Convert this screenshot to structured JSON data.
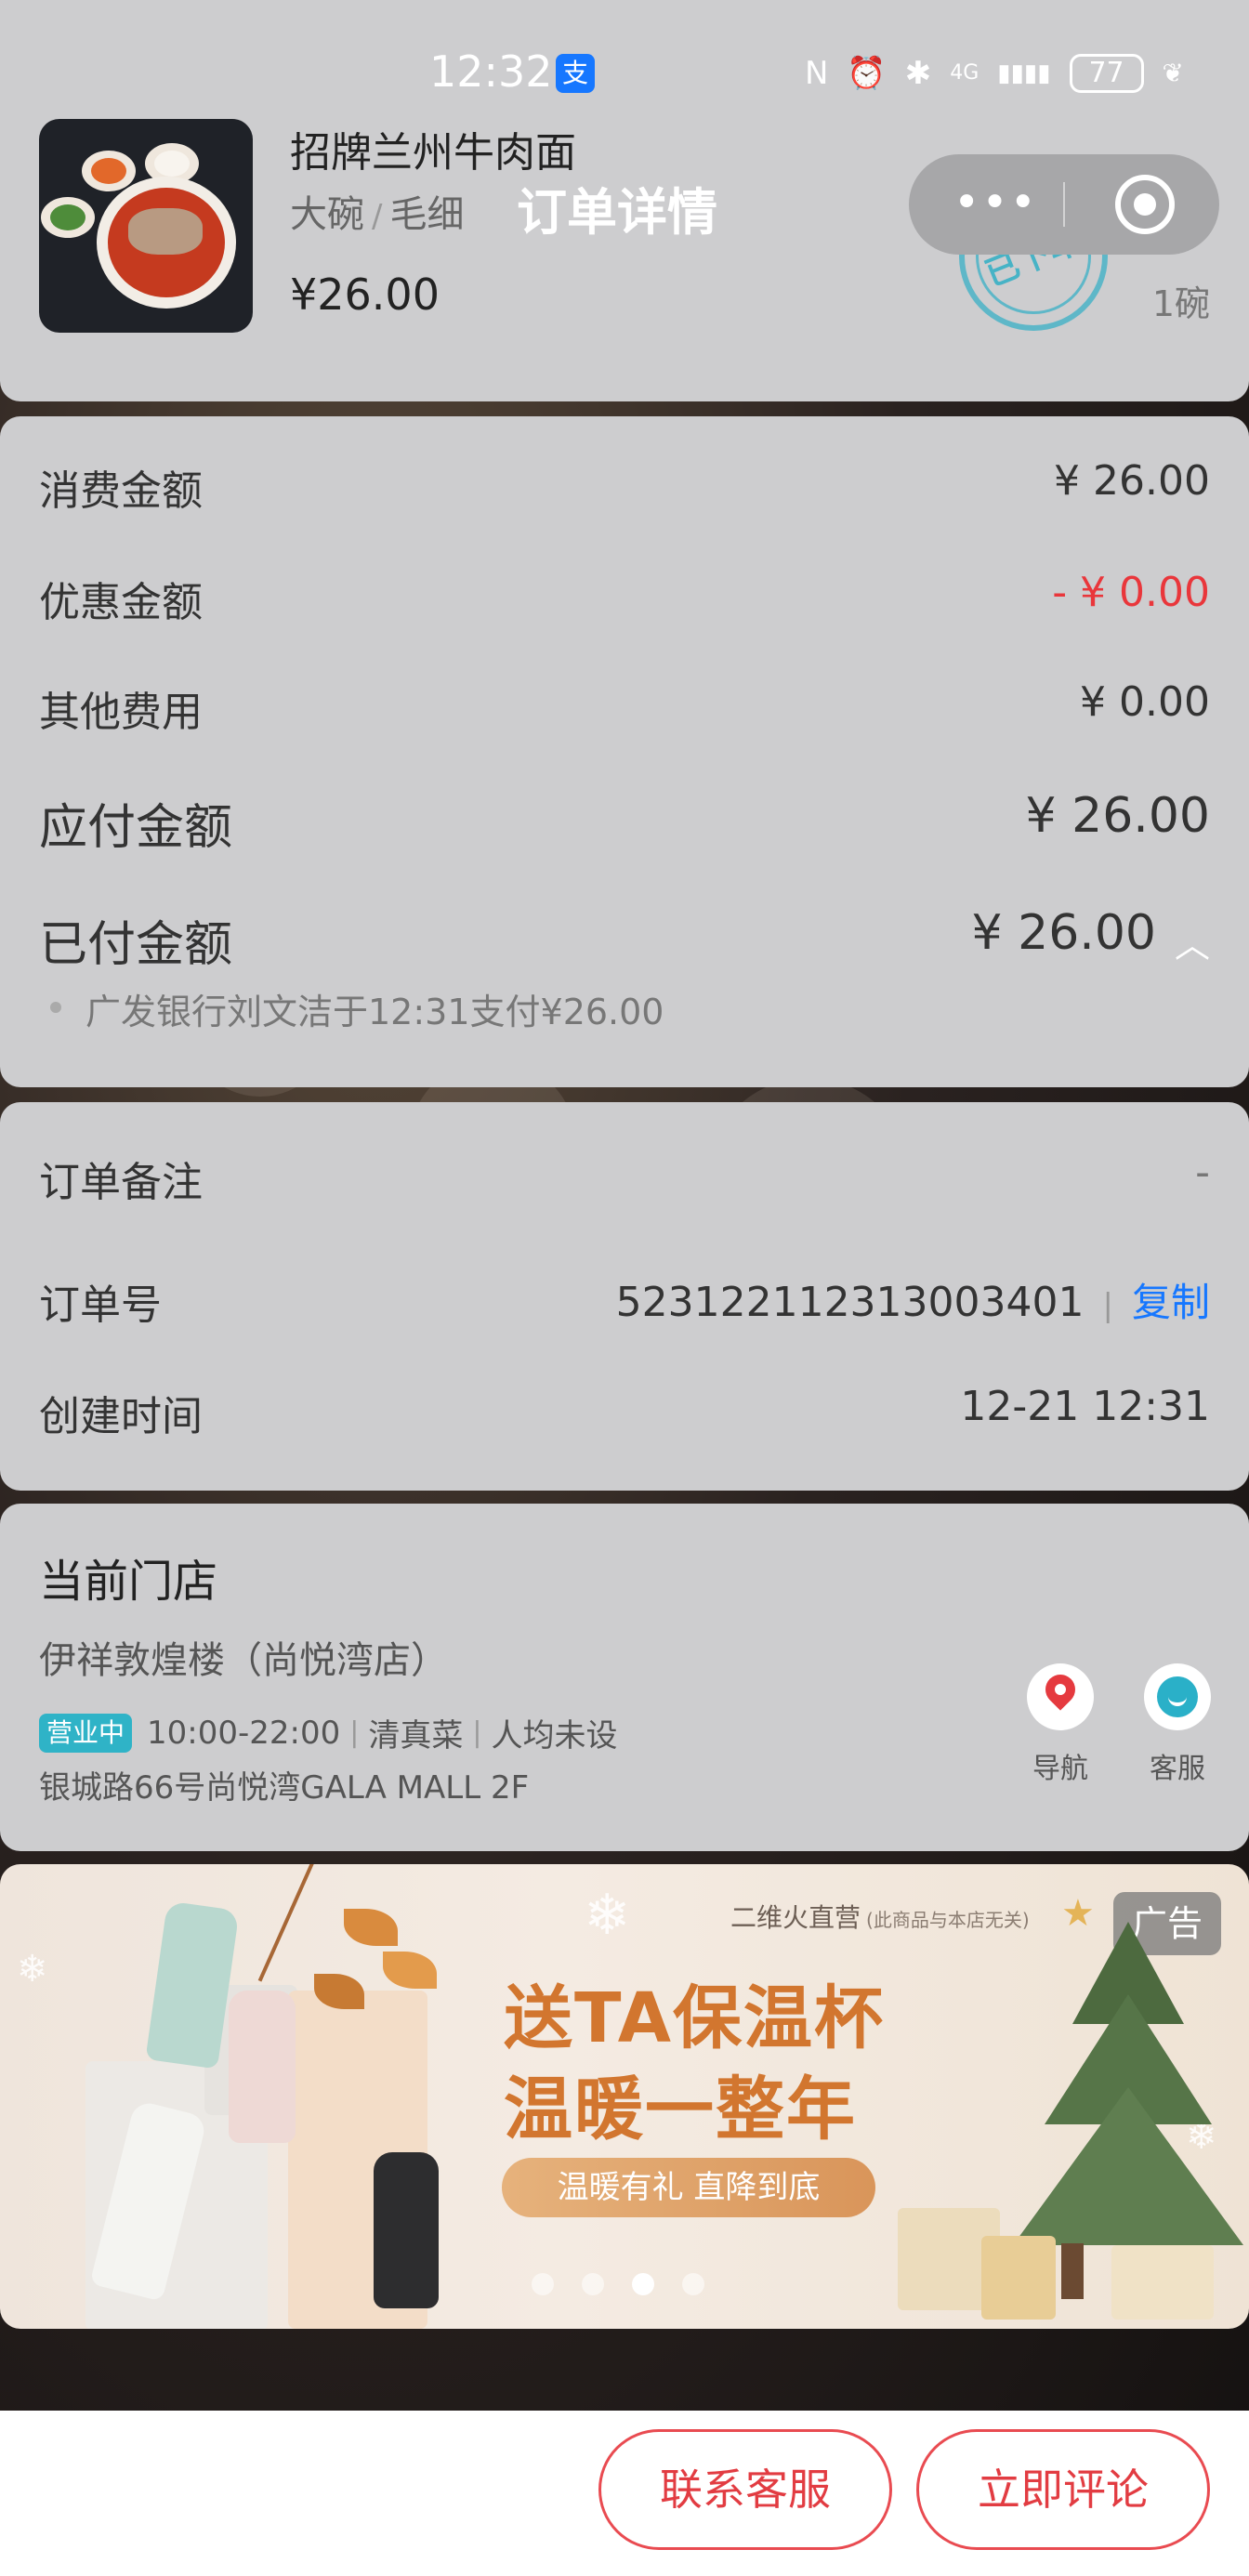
{
  "status_bar": {
    "time": "12:32",
    "alipay_icon_text": "支",
    "nfc": "N",
    "network": "4G",
    "signal": "▮▮▮▮",
    "battery": "77"
  },
  "product": {
    "name": "招牌兰州牛肉面",
    "spec_size": "大碗",
    "spec_sep": "/",
    "spec_noodle": "毛细",
    "price": "¥26.00",
    "quantity": "1碗",
    "stamp": "已下单"
  },
  "page": {
    "title": "订单详情",
    "capsule_more": "•••"
  },
  "amounts": {
    "consume_label": "消费金额",
    "consume_value": "¥ 26.00",
    "discount_label": "优惠金额",
    "discount_value": "- ¥ 0.00",
    "other_label": "其他费用",
    "other_value": "¥ 0.00",
    "payable_label": "应付金额",
    "payable_value": "¥ 26.00",
    "paid_label": "已付金额",
    "paid_value": "¥ 26.00",
    "paid_chevron": "︿",
    "paid_note": "广发银行刘文洁于12:31支付¥26.00"
  },
  "order": {
    "remark_label": "订单备注",
    "remark_value": "-",
    "number_label": "订单号",
    "number_value": "523122112313003401",
    "copy_sep": "|",
    "copy_label": "复制",
    "created_label": "创建时间",
    "created_value": "12-21 12:31"
  },
  "store": {
    "title": "当前门店",
    "name": "伊祥敦煌楼（尚悦湾店）",
    "status": "营业中",
    "hours": "10:00-22:00",
    "cuisine": "清真菜",
    "avg": "人均未设",
    "sep": "|",
    "address": "银城路66号尚悦湾GALA MALL 2F",
    "nav_label": "导航",
    "service_label": "客服"
  },
  "ad": {
    "source": "二维火直营",
    "source_note": "(此商品与本店无关)",
    "tag": "广告",
    "headline_1": "送TA保温杯",
    "headline_2": "温暖一整年",
    "cta": "温暖有礼 直降到底",
    "active_dot": 3,
    "dot_count": 4
  },
  "actions": {
    "contact": "联系客服",
    "review": "立即评论"
  },
  "colors": {
    "accent_blue": "#1677ff",
    "discount_red": "#e9363b",
    "button_red": "#e23c42",
    "open_badge": "#2fb3c7",
    "stamp_teal": "#2faec4"
  }
}
